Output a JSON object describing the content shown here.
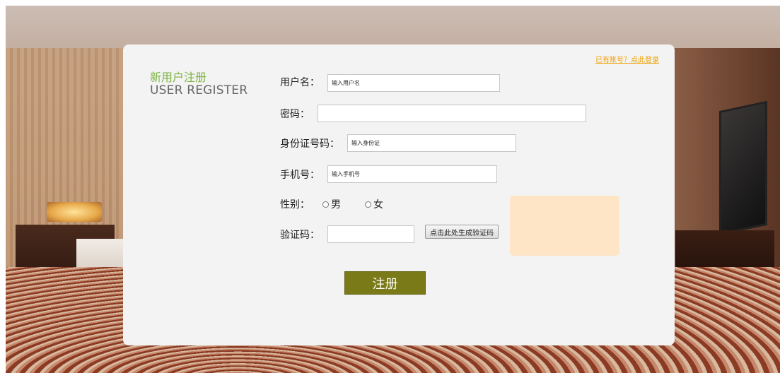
{
  "header": {
    "title_cn": "新用户注册",
    "title_en": "USER REGISTER",
    "login_link": "已有账号？点此登录"
  },
  "form": {
    "username": {
      "label": "用户名：",
      "placeholder": "输入用户名",
      "value": ""
    },
    "password": {
      "label": "密码：",
      "placeholder": "",
      "value": ""
    },
    "id_card": {
      "label": "身份证号码：",
      "placeholder": "输入身份证",
      "value": ""
    },
    "phone": {
      "label": "手机号：",
      "placeholder": "输入手机号",
      "value": ""
    },
    "gender": {
      "label": "性别：",
      "options": [
        "男",
        "女"
      ]
    },
    "captcha": {
      "label": "验证码：",
      "placeholder": "",
      "value": "",
      "button_label": "点击此处生成验证码"
    },
    "submit_label": "注册"
  },
  "colors": {
    "title_green": "#7cb342",
    "link_orange": "#f0a000",
    "submit_olive": "#7a7a18",
    "captcha_box": "#fde5c6",
    "card_bg": "#f3f3f3"
  }
}
